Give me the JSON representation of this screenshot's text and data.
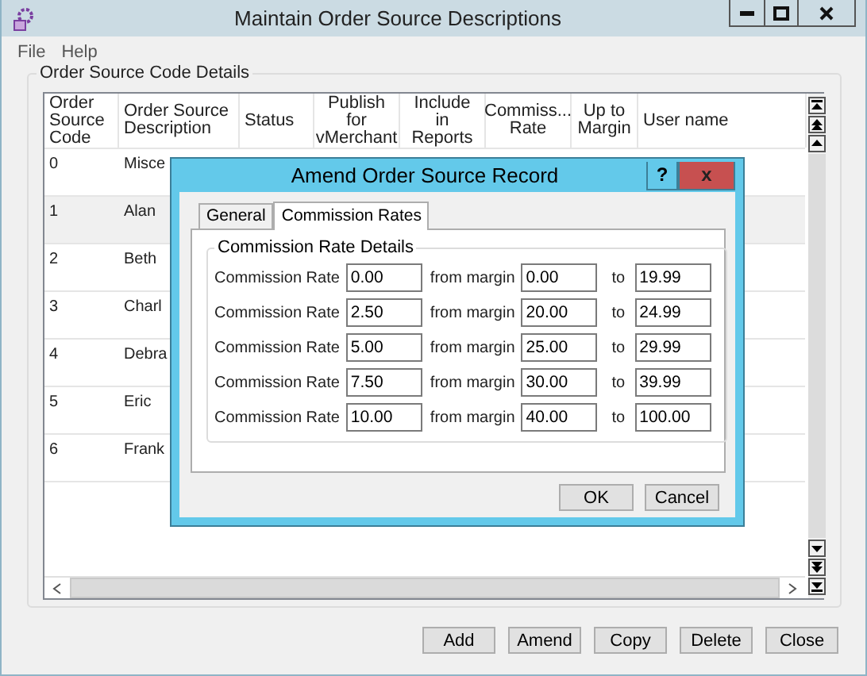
{
  "window": {
    "title": "Maintain Order Source Descriptions"
  },
  "menu": [
    "File",
    "Help"
  ],
  "group_title": "Order Source Code Details",
  "table": {
    "columns": [
      "Order Source Code",
      "Order Source Description",
      "Status",
      "Publish for vMerchant",
      "Include in Reports",
      "Commiss... Rate",
      "Up to Margin",
      "User name"
    ],
    "rows": [
      {
        "cells": [
          "0",
          "Misce"
        ],
        "selected": false
      },
      {
        "cells": [
          "1",
          "Alan"
        ],
        "selected": true
      },
      {
        "cells": [
          "2",
          "Beth"
        ],
        "selected": false
      },
      {
        "cells": [
          "3",
          "Charl"
        ],
        "selected": false
      },
      {
        "cells": [
          "4",
          "Debra"
        ],
        "selected": false
      },
      {
        "cells": [
          "5",
          "Eric"
        ],
        "selected": false
      },
      {
        "cells": [
          "6",
          "Frank"
        ],
        "selected": false
      }
    ]
  },
  "dialog": {
    "title": "Amend Order Source Record",
    "help": "?",
    "close": "x",
    "tabs": [
      {
        "label": "General",
        "selected": false
      },
      {
        "label": "Commission Rates",
        "selected": true
      }
    ],
    "group_title": "Commission Rate Details",
    "rows": [
      {
        "label": "Commission Rate",
        "rate": "0.00",
        "from_label": "from margin",
        "from": "0.00",
        "to_label": "to",
        "to": "19.99"
      },
      {
        "label": "Commission Rate",
        "rate": "2.50",
        "from_label": "from margin",
        "from": "20.00",
        "to_label": "to",
        "to": "24.99"
      },
      {
        "label": "Commission Rate",
        "rate": "5.00",
        "from_label": "from margin",
        "from": "25.00",
        "to_label": "to",
        "to": "29.99"
      },
      {
        "label": "Commission Rate",
        "rate": "7.50",
        "from_label": "from margin",
        "from": "30.00",
        "to_label": "to",
        "to": "39.99"
      },
      {
        "label": "Commission Rate",
        "rate": "10.00",
        "from_label": "from margin",
        "from": "40.00",
        "to_label": "to",
        "to": "100.00"
      }
    ],
    "buttons": [
      "OK",
      "Cancel"
    ]
  },
  "buttons": [
    "Add",
    "Amend",
    "Copy",
    "Delete",
    "Close"
  ]
}
